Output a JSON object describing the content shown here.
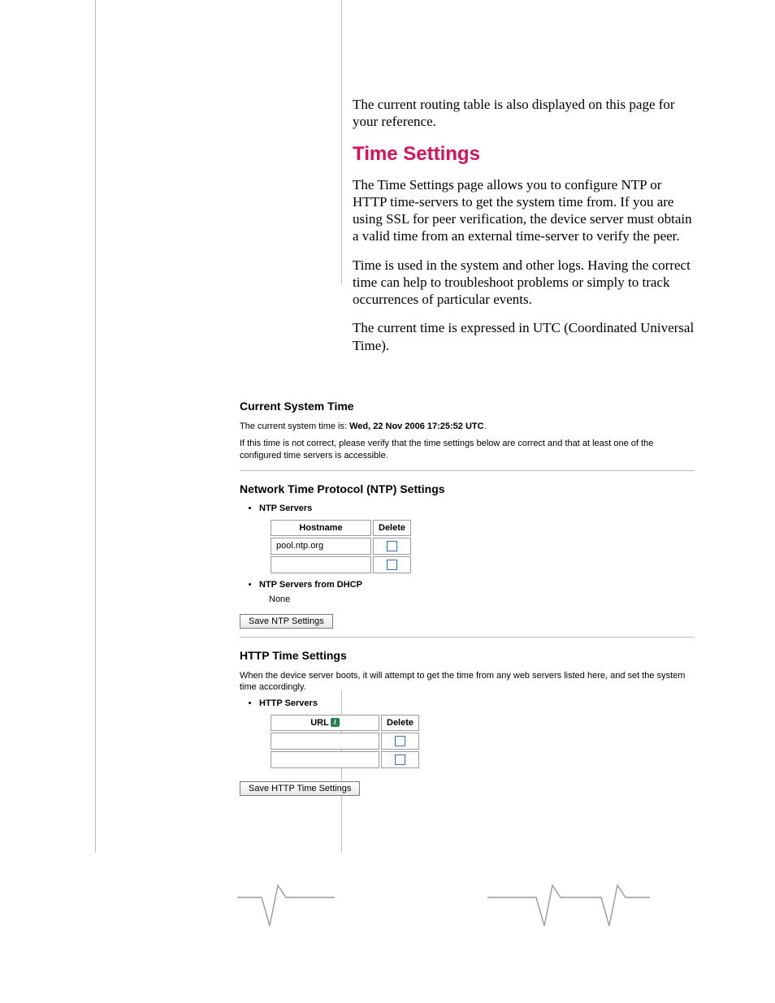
{
  "intro": {
    "routing_note": "The current routing table is also displayed on this page for your reference."
  },
  "section": {
    "title": "Time Settings",
    "para1": "The Time Settings page allows you to configure NTP or HTTP time-servers to get the system time from. If you are using SSL for peer verification, the device server must obtain a valid time from an external time-server to verify the peer.",
    "para2": "Time is used in the system and other logs. Having the correct time can help to troubleshoot problems or simply to track occurrences of particular events.",
    "para3": "The current time is expressed in UTC (Coordinated Universal Time)."
  },
  "current_time": {
    "heading": "Current System Time",
    "prefix": "The current system time is: ",
    "value": "Wed, 22 Nov 2006 17:25:52 UTC",
    "suffix": ".",
    "note": "If this time is not correct, please verify that the time settings below are correct and that at least one of the configured time servers is accessible."
  },
  "ntp": {
    "heading": "Network Time Protocol (NTP) Settings",
    "servers_label": "NTP Servers",
    "col_host": "Hostname",
    "col_delete": "Delete",
    "rows": [
      {
        "host": "pool.ntp.org"
      },
      {
        "host": ""
      }
    ],
    "dhcp_label": "NTP Servers from DHCP",
    "dhcp_value": "None",
    "save_label": "Save NTP Settings"
  },
  "http": {
    "heading": "HTTP Time Settings",
    "note": "When the device server boots, it will attempt to get the time from any web servers listed here, and set the system time accordingly.",
    "servers_label": "HTTP Servers",
    "col_url": "URL",
    "col_delete": "Delete",
    "rows": [
      {
        "url": ""
      },
      {
        "url": ""
      }
    ],
    "save_label": "Save HTTP Time Settings"
  }
}
